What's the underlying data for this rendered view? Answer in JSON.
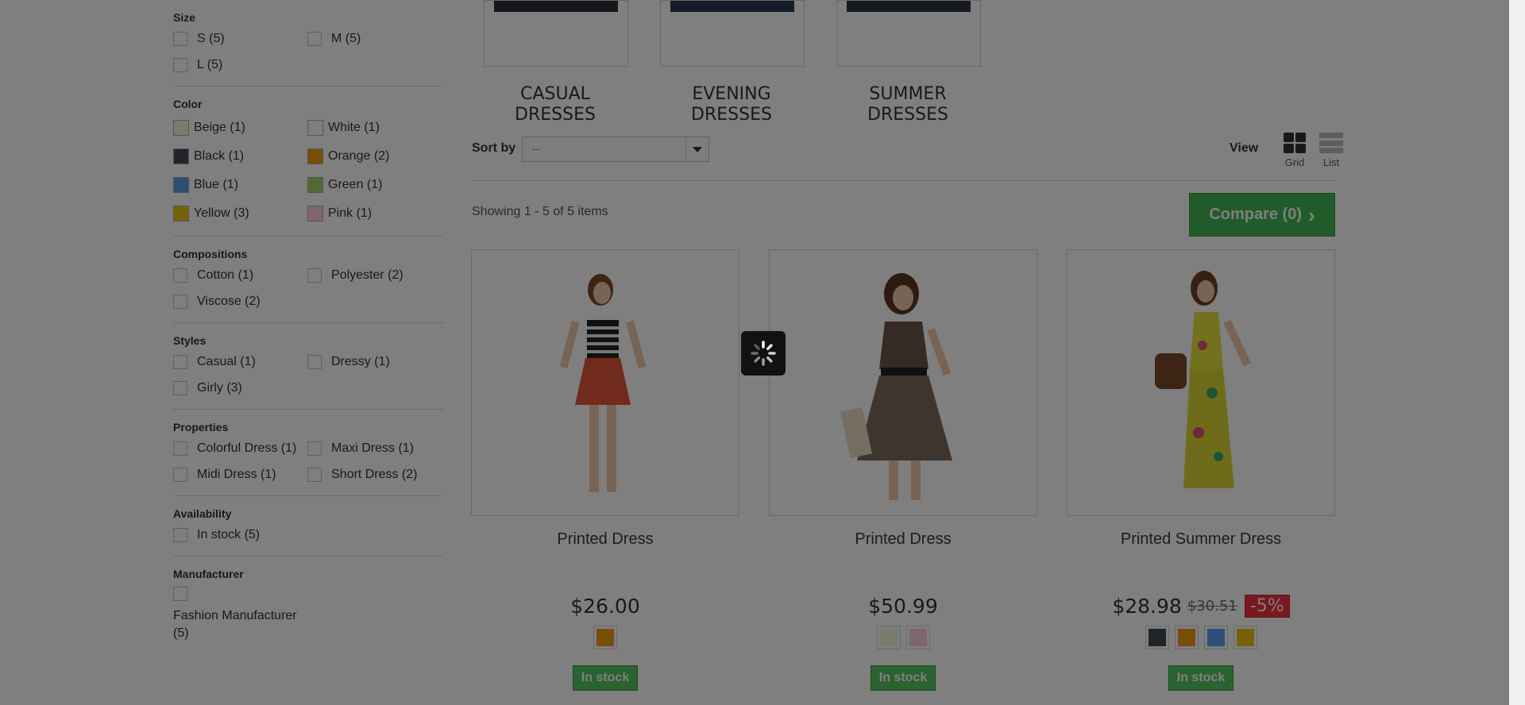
{
  "filters": {
    "size": {
      "title": "Size",
      "items": [
        {
          "label": "S (5)"
        },
        {
          "label": "M (5)"
        },
        {
          "label": "L (5)"
        }
      ]
    },
    "color": {
      "title": "Color",
      "items": [
        {
          "label": "Beige (1)",
          "color": "#f5f5dc"
        },
        {
          "label": "White (1)",
          "color": "#ffffff"
        },
        {
          "label": "Black (1)",
          "color": "#434a54"
        },
        {
          "label": "Orange (2)",
          "color": "#f39c11"
        },
        {
          "label": "Blue (1)",
          "color": "#5d9cec"
        },
        {
          "label": "Green (1)",
          "color": "#a0d468"
        },
        {
          "label": "Yellow (3)",
          "color": "#f1c40f"
        },
        {
          "label": "Pink (1)",
          "color": "#fcccd8"
        }
      ]
    },
    "compositions": {
      "title": "Compositions",
      "items": [
        {
          "label": "Cotton (1)"
        },
        {
          "label": "Polyester (2)"
        },
        {
          "label": "Viscose (2)"
        }
      ]
    },
    "styles": {
      "title": "Styles",
      "items": [
        {
          "label": "Casual (1)"
        },
        {
          "label": "Dressy (1)"
        },
        {
          "label": "Girly (3)"
        }
      ]
    },
    "properties": {
      "title": "Properties",
      "items": [
        {
          "label": "Colorful Dress (1)"
        },
        {
          "label": "Maxi Dress (1)"
        },
        {
          "label": "Midi Dress (1)"
        },
        {
          "label": "Short Dress (2)"
        }
      ]
    },
    "availability": {
      "title": "Availability",
      "items": [
        {
          "label": "In stock (5)"
        }
      ]
    },
    "manufacturer": {
      "title": "Manufacturer",
      "items": [
        {
          "label": "Fashion Manufacturer (5)"
        }
      ]
    }
  },
  "subcategories": [
    {
      "name": "CASUAL\nDRESSES"
    },
    {
      "name": "EVENING\nDRESSES"
    },
    {
      "name": "SUMMER\nDRESSES"
    }
  ],
  "sort": {
    "label": "Sort by",
    "value": "--"
  },
  "view": {
    "label": "View",
    "grid_label": "Grid",
    "list_label": "List"
  },
  "showing": "Showing 1 - 5 of 5 items",
  "compare": {
    "label": "Compare (0)"
  },
  "products": [
    {
      "name": "Printed Dress",
      "price": "$26.00",
      "old_price": "",
      "reduction": "",
      "colors": [
        "#f39c11"
      ],
      "stock": "In stock"
    },
    {
      "name": "Printed Dress",
      "price": "$50.99",
      "old_price": "",
      "reduction": "",
      "colors": [
        "#f5f5dc",
        "#fcccd8"
      ],
      "stock": "In stock"
    },
    {
      "name": "Printed Summer Dress",
      "price": "$28.98",
      "old_price": "$30.51",
      "reduction": "-5%",
      "colors": [
        "#434a54",
        "#f39c11",
        "#5d9cec",
        "#f1c40f"
      ],
      "stock": "In stock"
    }
  ]
}
